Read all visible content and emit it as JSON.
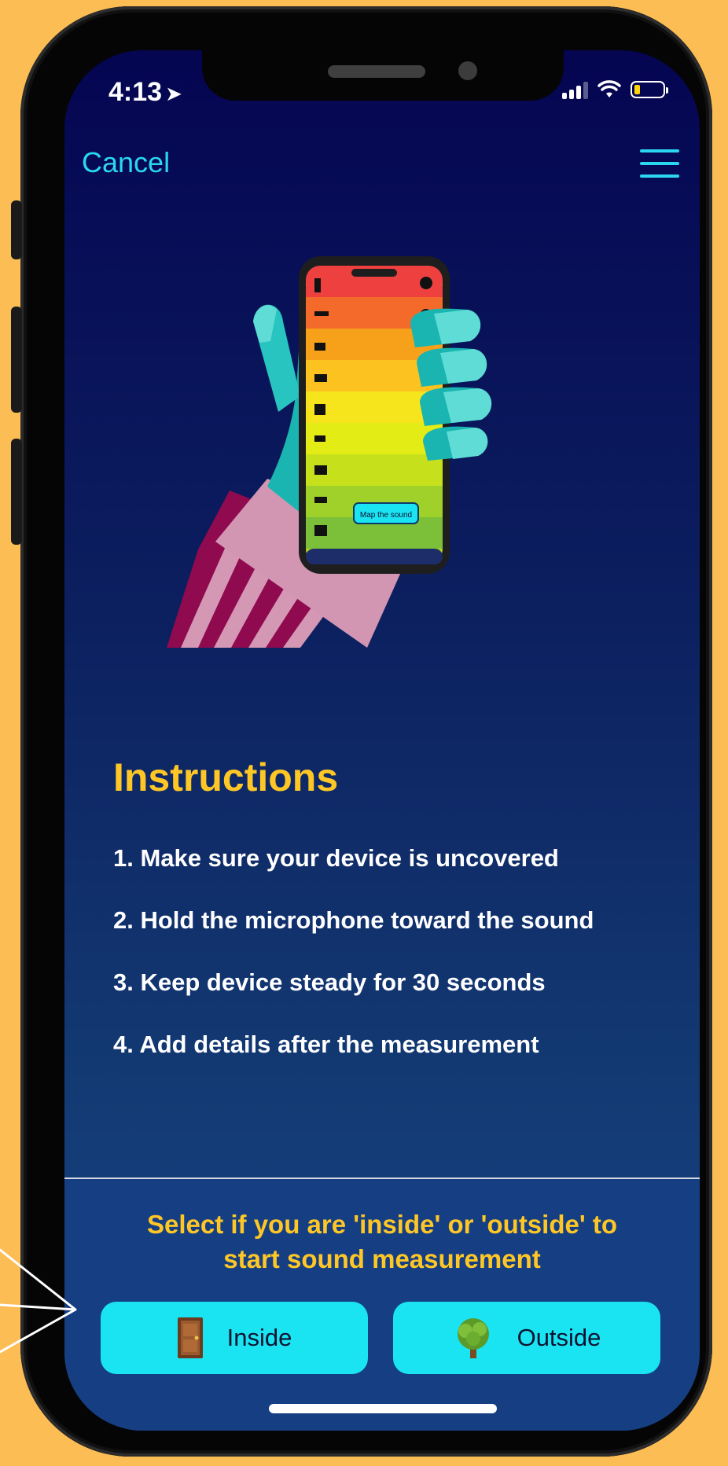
{
  "status_bar": {
    "time": "4:13"
  },
  "nav": {
    "cancel_label": "Cancel"
  },
  "illustration": {
    "phone_button_label": "Map the sound"
  },
  "instructions": {
    "title": "Instructions",
    "steps": [
      "1. Make sure your device is uncovered",
      "2. Hold the microphone toward the sound",
      "3. Keep device steady for 30 seconds",
      "4. Add details after the measurement"
    ]
  },
  "footer": {
    "prompt_line1": "Select if you are 'inside' or 'outside' to",
    "prompt_line2": "start sound measurement",
    "inside_label": "Inside",
    "outside_label": "Outside"
  },
  "colors": {
    "background": "#FDBD55",
    "accent_cyan": "#1be4f2",
    "accent_yellow": "#FFC726",
    "screen_top": "#050552",
    "screen_bottom": "#174486"
  }
}
